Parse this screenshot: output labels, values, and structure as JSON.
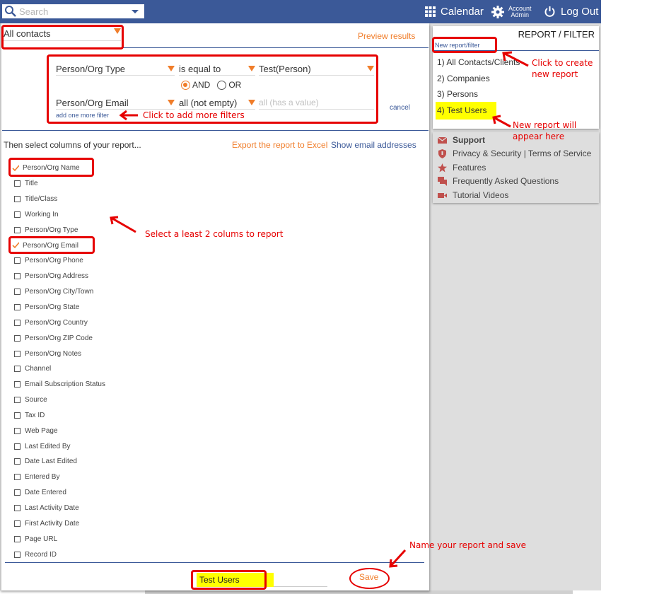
{
  "topbar": {
    "search_placeholder": "Search",
    "calendar_label": "Calendar",
    "account_line1": "Account",
    "account_line2": "Admin",
    "logout_label": "Log Out",
    "icons": {
      "search": "search-icon",
      "calendar": "grid-icon",
      "account": "gear-icon",
      "logout": "power-icon"
    }
  },
  "main": {
    "contacts_select": "All contacts",
    "preview_link": "Preview results",
    "filters": [
      {
        "field": "Person/Org Type",
        "operator": "is equal to",
        "value": "Test(Person)",
        "value_is_placeholder": false
      },
      {
        "field": "Person/Org Email",
        "operator": "all (not empty)",
        "value": "all (has a value)",
        "value_is_placeholder": true
      }
    ],
    "logic": {
      "options": [
        "AND",
        "OR"
      ],
      "selected": "AND"
    },
    "add_filter_link": "add one more filter",
    "cancel_link": "cancel",
    "columns_heading": "Then select columns of your report...",
    "export_link": "Export the report to Excel",
    "show_emails_link": "Show email addresses",
    "columns": [
      {
        "label": "Person/Org Name",
        "checked": true
      },
      {
        "label": "Title",
        "checked": false
      },
      {
        "label": "Title/Class",
        "checked": false
      },
      {
        "label": "Working In",
        "checked": false
      },
      {
        "label": "Person/Org Type",
        "checked": false
      },
      {
        "label": "Person/Org Email",
        "checked": true
      },
      {
        "label": "Person/Org Phone",
        "checked": false
      },
      {
        "label": "Person/Org Address",
        "checked": false
      },
      {
        "label": "Person/Org City/Town",
        "checked": false
      },
      {
        "label": "Person/Org State",
        "checked": false
      },
      {
        "label": "Person/Org Country",
        "checked": false
      },
      {
        "label": "Person/Org ZIP Code",
        "checked": false
      },
      {
        "label": "Person/Org Notes",
        "checked": false
      },
      {
        "label": "Channel",
        "checked": false
      },
      {
        "label": "Email Subscription Status",
        "checked": false
      },
      {
        "label": "Source",
        "checked": false
      },
      {
        "label": "Tax ID",
        "checked": false
      },
      {
        "label": "Web Page",
        "checked": false
      },
      {
        "label": "Last Edited By",
        "checked": false
      },
      {
        "label": "Date Last Edited",
        "checked": false
      },
      {
        "label": "Entered By",
        "checked": false
      },
      {
        "label": "Date Entered",
        "checked": false
      },
      {
        "label": "Last Activity Date",
        "checked": false
      },
      {
        "label": "First Activity Date",
        "checked": false
      },
      {
        "label": "Page URL",
        "checked": false
      },
      {
        "label": "Record ID",
        "checked": false
      }
    ],
    "report_name_value": "Test Users",
    "save_button": "Save"
  },
  "sidebar": {
    "title": "REPORT / FILTER",
    "new_report_link": "New report/filter",
    "reports": [
      {
        "label": "1) All Contacts/Clients",
        "highlighted": false
      },
      {
        "label": "2) Companies",
        "highlighted": false
      },
      {
        "label": "3) Persons",
        "highlighted": false
      },
      {
        "label": "4) Test Users",
        "highlighted": true
      }
    ],
    "support": [
      {
        "label": "Support",
        "icon": "mail-icon",
        "bold": true
      },
      {
        "label": "Privacy & Security | Terms of Service",
        "icon": "shield-icon",
        "bold": false
      },
      {
        "label": "Features",
        "icon": "star-icon",
        "bold": false
      },
      {
        "label": "Frequently Asked Questions",
        "icon": "chat-icon",
        "bold": false
      },
      {
        "label": "Tutorial Videos",
        "icon": "video-icon",
        "bold": false
      }
    ]
  },
  "annotations": {
    "add_filters": "Click to add more filters",
    "select_columns": "Select a least 2 colums to report",
    "create_report_line1": "Click to create",
    "create_report_line2": "new report",
    "new_report_line1": "New report will",
    "new_report_line2": "appear here",
    "name_and_save": "Name your report and save"
  },
  "colors": {
    "brand_blue": "#3b5998",
    "accent_orange": "#f07d2a",
    "annotation_red": "#e60000",
    "highlight_yellow": "#ffff00",
    "support_icon_red": "#c0504d"
  }
}
